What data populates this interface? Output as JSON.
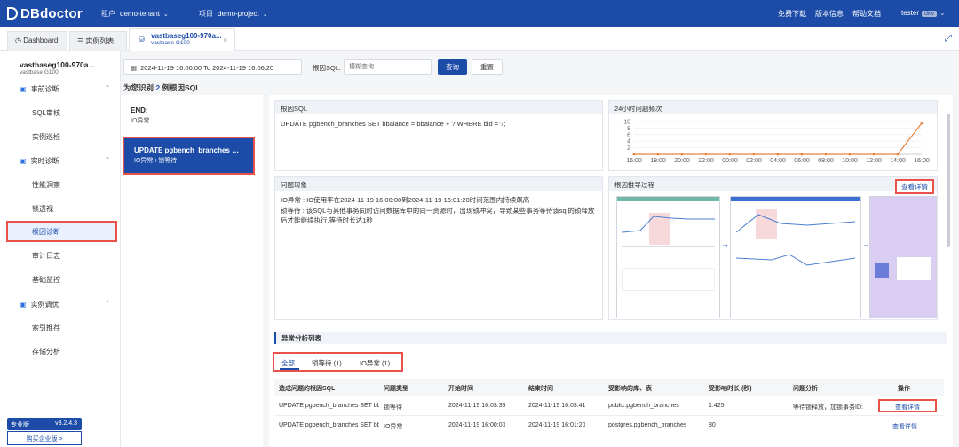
{
  "topnav": {
    "brand": "DBdoctor",
    "tenant_label": "租户",
    "tenant_value": "demo-tenant",
    "project_label": "项目",
    "project_value": "demo-project",
    "download": "免费下载",
    "version_info": "版本信息",
    "help": "帮助文档",
    "user": "tester",
    "user_badge": "dev"
  },
  "tabs": {
    "dashboard": "Dashboard",
    "instances": "实例列表",
    "active_title": "vastbaseg100-970a...",
    "active_sub": "vastbase G100"
  },
  "sidebar": {
    "instance_name": "vastbaseg100-970a...",
    "instance_type": "vastbase G100",
    "groups": [
      {
        "label": "事前诊断",
        "items": [
          "SQL审核",
          "实例巡检"
        ]
      },
      {
        "label": "实时诊断",
        "items": [
          "性能洞察",
          "锁透视",
          "根因诊断",
          "审计日志",
          "基础监控"
        ]
      },
      {
        "label": "实例调优",
        "items": [
          "索引推荐",
          "存储分析"
        ]
      }
    ],
    "plan": "专业版",
    "plan_version": "v3.2.4.3",
    "buy_button": "购买企业版 >"
  },
  "filter": {
    "date_range": "2024-11-19 16:00:00 To 2024-11-19 16:06:20",
    "sql_label": "根因SQL:",
    "sql_placeholder": "模糊查询",
    "query_button": "查询",
    "reset_button": "重置"
  },
  "identified": {
    "prefix": "为您识别",
    "count": "2",
    "suffix": "例根因SQL"
  },
  "root_causes": [
    {
      "title": "END:",
      "tag": "IO异常"
    },
    {
      "title": "UPDATE pgbench_branches SET b...",
      "tag": "IO异常 \\ 锁等待"
    }
  ],
  "panels": {
    "root_sql_title": "根因SQL",
    "root_sql_text": "UPDATE pgbench_branches SET bbalance = bbalance + ? WHERE bid = ?;",
    "freq_title": "24小时问题频次",
    "symptom_title": "问题现象",
    "symptom_line1": "IO异常 : IO使用率在2024-11-19 16:00:00到2024-11-19 16:01:20时间范围内持续飙高",
    "symptom_line2": "锁等待 : 该SQL与其他事务同时访问数据库中的同一资源时，出现锁冲突，导致某些事务等待该sql的锁释放后才能继续执行,等待时长达1秒",
    "derivation_title": "根因推导过程",
    "view_detail": "查看详情"
  },
  "chart_data": {
    "type": "line",
    "x": [
      "16:00",
      "18:00",
      "20:00",
      "22:00",
      "00:00",
      "02:00",
      "04:00",
      "06:00",
      "08:00",
      "10:00",
      "12:00",
      "14:00",
      "16:00"
    ],
    "series": [
      {
        "values": [
          0,
          0,
          0,
          0,
          0,
          0,
          0,
          0,
          0,
          0,
          0,
          0,
          9.5
        ]
      }
    ],
    "y_ticks": [
      "10",
      "8",
      "6",
      "4",
      "2"
    ],
    "ylim": [
      0,
      10
    ],
    "color": "#e8823a",
    "grid": true
  },
  "anomaly": {
    "section_title": "异常分析列表",
    "tabs": [
      "全部",
      "锁等待 (1)",
      "IO异常 (1)"
    ],
    "columns": [
      "造成问题的根因SQL",
      "问题类型",
      "开始时间",
      "结束时间",
      "受影响的库、表",
      "受影响时长 (秒)",
      "问题分析",
      "操作"
    ],
    "rows": [
      [
        "UPDATE pgbench_branches SET bb",
        "锁等待",
        "2024-11-19 16:03:39",
        "2024-11-19 16:03:41",
        "public.pgbench_branches",
        "1.425",
        "等待锁释放，加锁事务ID:",
        "查看详情"
      ],
      [
        "UPDATE pgbench_branches SET bb",
        "IO异常",
        "2024-11-19 16:00:00",
        "2024-11-19 16:01:20",
        "postgres.pgbench_branches",
        "80",
        "",
        "查看详情"
      ]
    ]
  }
}
